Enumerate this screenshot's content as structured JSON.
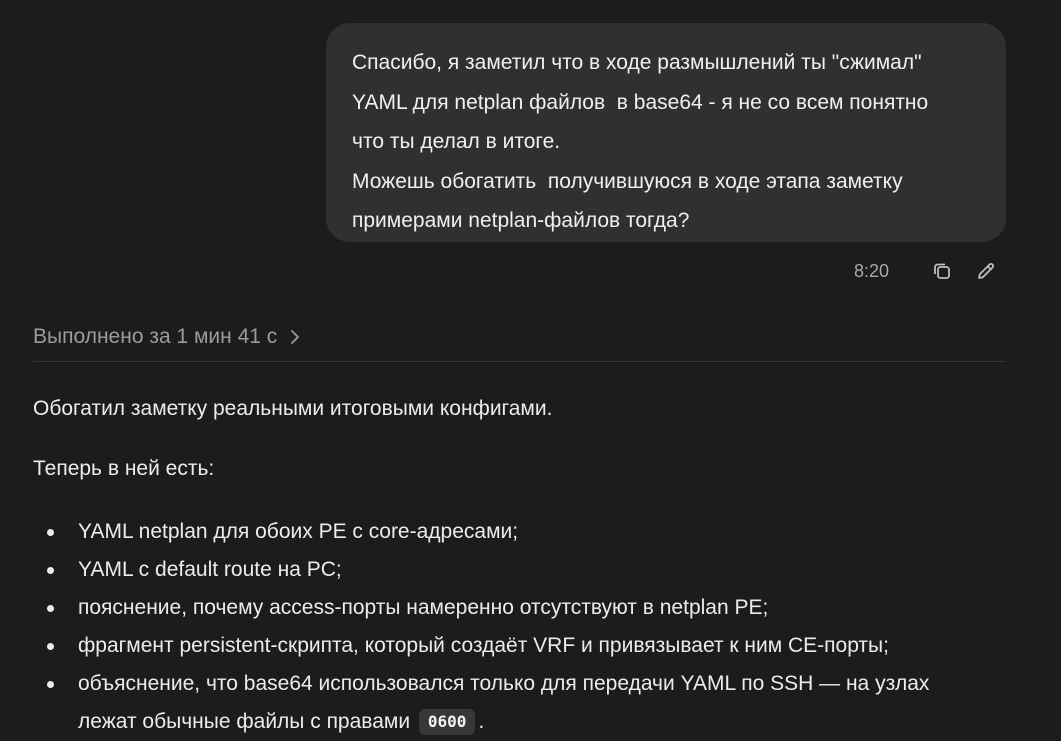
{
  "user_message": {
    "lines": [
      "Спасибо, я заметил что в ходе размышлений ты \"сжимал\"",
      "YAML для netplan файлов  в base64 - я не со всем понятно",
      "что ты делал в итоге.",
      "Можешь обогатить  получившуюся в ходе этапа заметку",
      "примерами netplan-файлов тогда?"
    ],
    "time": "8:20",
    "icons": {
      "copy": "copy-icon",
      "edit": "pencil-icon"
    }
  },
  "thinking": {
    "label": "Выполнено за 1 мин 41 с",
    "icon": "chevron-right-icon"
  },
  "answer": {
    "intro": "Обогатил заметку реальными итоговыми конфигами.",
    "lead": "Теперь в ней есть:",
    "bullets": [
      "YAML netplan для обоих PE с core-адресами;",
      "YAML с default route на PC;",
      "пояснение, почему access-порты намеренно отсутствуют в netplan PE;",
      "фрагмент persistent-скрипта, который создаёт VRF и привязывает к ним CE-порты;"
    ],
    "last_bullet": {
      "line1": "объяснение, что base64 использовался только для передачи YAML по SSH — на узлах",
      "line2_before": "лежат обычные файлы с правами",
      "code": "0600",
      "line2_after": "."
    }
  },
  "colors": {
    "background": "#1c1c1c",
    "bubble": "#303030",
    "text": "#ececec",
    "muted": "#9b9b9b"
  }
}
